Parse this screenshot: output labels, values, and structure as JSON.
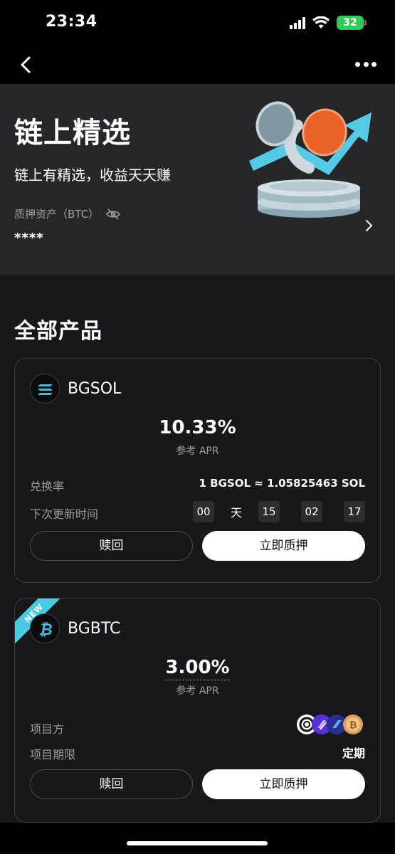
{
  "status_bar": {
    "time": "23:34",
    "battery": "32"
  },
  "hero": {
    "title": "链上精选",
    "subtitle": "链上有精选，收益天天赚",
    "asset_label": "质押资产（BTC）",
    "asset_value": "****"
  },
  "section_title": "全部产品",
  "products": [
    {
      "name": "BGSOL",
      "apr": "10.33%",
      "apr_label": "参考 APR",
      "rate_label": "兑换率",
      "rate_value": "1 BGSOL ≈ 1.05825463 SOL",
      "update_label": "下次更新时间",
      "countdown": {
        "days": "00",
        "day_unit": "天",
        "hours": "15",
        "minutes": "02",
        "seconds": "17"
      },
      "redeem_label": "赎回",
      "stake_label": "立即质押",
      "logo_color": "#4fb6d8"
    },
    {
      "name": "BGBTC",
      "badge": "NEW",
      "apr": "3.00%",
      "apr_label": "参考 APR",
      "project_label": "项目方",
      "period_label": "项目期限",
      "period_value": "定期",
      "redeem_label": "赎回",
      "stake_label": "立即质押",
      "logo_color": "#4fb6d8"
    }
  ],
  "colors": {
    "accent": "#4ec8e0",
    "card_border": "#3c3e44",
    "muted_text": "#9a9ca3"
  }
}
